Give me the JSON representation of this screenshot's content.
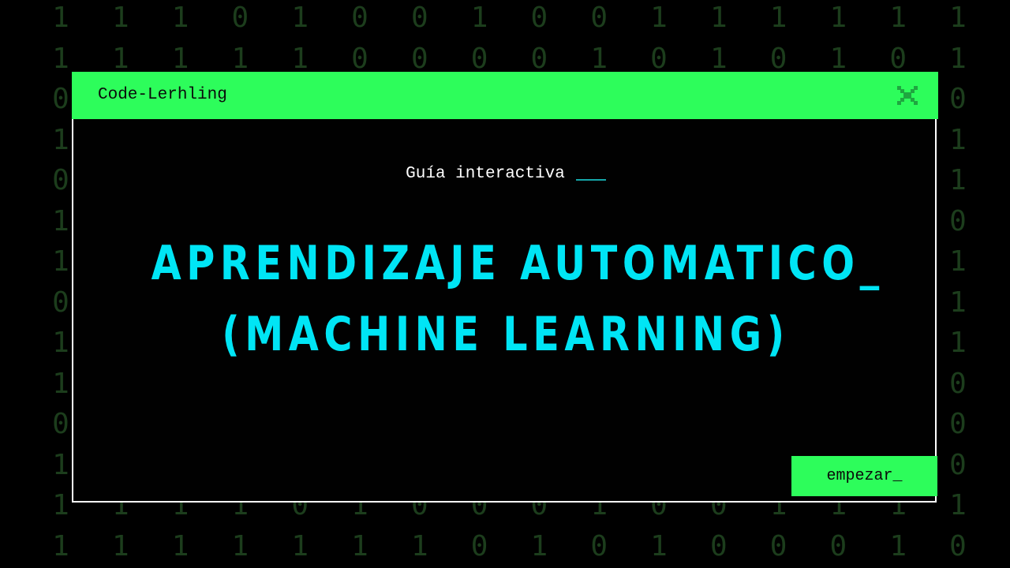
{
  "window": {
    "title": "Code-Lerhling",
    "close_icon": "close-x-icon"
  },
  "content": {
    "subtitle": "Guía interactiva",
    "title_line1": "APRENDIZAJE AUTOMATICO_",
    "title_line2": "(MACHINE LEARNING)"
  },
  "actions": {
    "start_label": "empezar_"
  },
  "background": {
    "rows": [
      "1110100100111111",
      "1111100001010101",
      "0111110000010010",
      "1100001111011101",
      "0100000111100001",
      "1001000010111100",
      "1000000001111001",
      "0101000000000111",
      "1101010101110101",
      "1101001011010110",
      "0011011111110000",
      "1010100101010110",
      "1111010001001111",
      "1111111010100010"
    ]
  },
  "colors": {
    "accent_green": "#2dfd5b",
    "title_cyan": "#00e5f5",
    "digit_green": "#1c3d1c",
    "background": "#000000",
    "window_border": "#ffffff"
  }
}
